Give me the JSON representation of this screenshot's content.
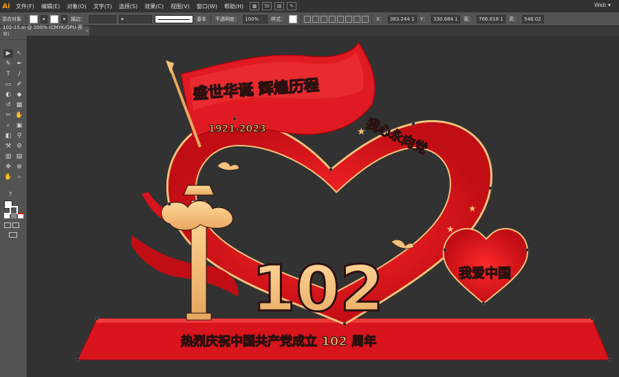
{
  "app": {
    "logo": "Ai",
    "workspace": "Web ▾"
  },
  "menus": [
    "文件(F)",
    "编辑(E)",
    "对象(O)",
    "文字(T)",
    "选择(S)",
    "效果(C)",
    "视图(V)",
    "窗口(W)",
    "帮助(H)"
  ],
  "control": {
    "mode_label": "混合对象",
    "stroke_label": "描边：",
    "stroke_value": "",
    "stroke_style": "基本",
    "opacity_label": "不透明度：",
    "opacity_value": "100%",
    "style_label": "样式：",
    "x_label": "X：",
    "x_value": "383.244 1",
    "y_label": "Y：",
    "y_value": "330.684 1",
    "w_label": "宽：",
    "w_value": "766.618 1",
    "h_label": "高：",
    "h_value": "546.02"
  },
  "document": {
    "tab_label": "102-15.ai @ 200% (CMYK/GPU 预览)",
    "close": "×"
  },
  "tools": [
    "▶",
    "↖",
    "✎",
    "✒",
    "T",
    "/",
    "▭",
    "✐",
    "◐",
    "◆",
    "↺",
    "▦",
    "✂",
    "✋",
    "⌕",
    "▣",
    "◧",
    "⚲",
    "⚒",
    "⚙",
    "▥",
    "▤",
    "✥",
    "⊕",
    "?",
    "▢",
    "□",
    "▧"
  ],
  "artwork": {
    "flag_text": "盛世华诞 辉煌历程",
    "year": "1921-2023",
    "arc_text": "我心永向党",
    "number": "102",
    "heart_text": "我爱中国",
    "base_text": "热烈庆祝中国共产党成立 102 周年",
    "colors": {
      "red": "#e01a22",
      "dark_red": "#a8080f",
      "gold": "#f3c27c",
      "outline": "#2b1010"
    }
  }
}
